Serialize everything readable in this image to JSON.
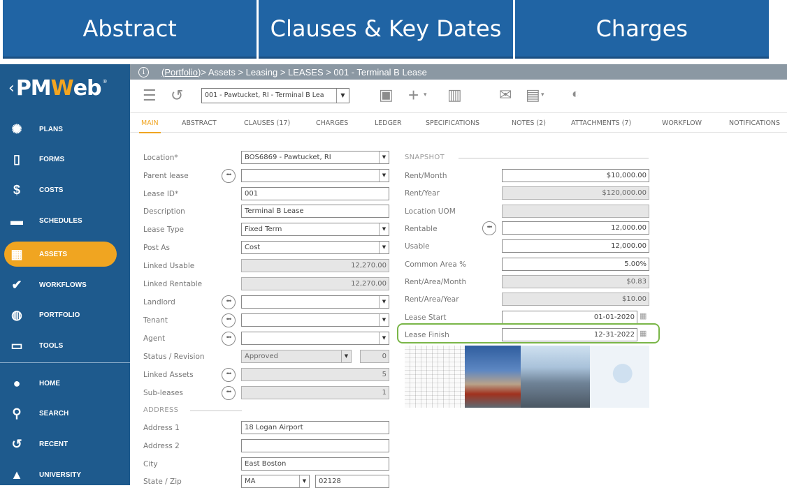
{
  "banner": {
    "tabs": [
      "Abstract",
      "Clauses & Key Dates",
      "Charges"
    ]
  },
  "sidebar": {
    "logo": {
      "arrow": "‹",
      "pm": "PM",
      "w": "W",
      "eb": "eb",
      "reg": "®"
    },
    "items": [
      {
        "icon": "plans-icon",
        "glyph": "✺",
        "label": "PLANS"
      },
      {
        "icon": "forms-icon",
        "glyph": "▯",
        "label": "FORMS"
      },
      {
        "icon": "costs-icon",
        "glyph": "$",
        "label": "COSTS"
      },
      {
        "icon": "schedules-icon",
        "glyph": "▬",
        "label": "SCHEDULES"
      },
      {
        "icon": "assets-icon",
        "glyph": "▦",
        "label": "ASSETS"
      },
      {
        "icon": "workflows-icon",
        "glyph": "✔",
        "label": "WORKFLOWS"
      },
      {
        "icon": "portfolio-icon",
        "glyph": "◍",
        "label": "PORTFOLIO"
      },
      {
        "icon": "tools-icon",
        "glyph": "▭",
        "label": "TOOLS"
      },
      {
        "icon": "home-icon",
        "glyph": "●",
        "label": "HOME"
      },
      {
        "icon": "search-icon",
        "glyph": "⚲",
        "label": "SEARCH"
      },
      {
        "icon": "recent-icon",
        "glyph": "↺",
        "label": "RECENT"
      },
      {
        "icon": "university-icon",
        "glyph": "▲",
        "label": "UNIVERSITY"
      }
    ],
    "active": "ASSETS"
  },
  "breadcrumb": {
    "info": "i",
    "link": "(Portfolio)",
    "rest": " > Assets > Leasing > LEASES > 001 - Terminal B Lease"
  },
  "toolbar": {
    "record": "001 - Pawtucket, RI - Terminal B Lea"
  },
  "tabs": [
    "MAIN",
    "ABSTRACT",
    "CLAUSES (17)",
    "CHARGES",
    "LEDGER",
    "SPECIFICATIONS",
    "NOTES (2)",
    "ATTACHMENTS (7)",
    "WORKFLOW",
    "NOTIFICATIONS"
  ],
  "form": {
    "location_label": "Location*",
    "location": "BOS6869 - Pawtucket, RI",
    "parent_label": "Parent lease",
    "parent": "",
    "lease_id_label": "Lease ID*",
    "lease_id": "001",
    "description_label": "Description",
    "description": "Terminal B Lease",
    "lease_type_label": "Lease Type",
    "lease_type": "Fixed Term",
    "post_as_label": "Post As",
    "post_as": "Cost",
    "linked_usable_label": "Linked Usable",
    "linked_usable": "12,270.00",
    "linked_rentable_label": "Linked Rentable",
    "linked_rentable": "12,270.00",
    "landlord_label": "Landlord",
    "landlord": "",
    "tenant_label": "Tenant",
    "tenant": "",
    "agent_label": "Agent",
    "agent": "",
    "status_label": "Status / Revision",
    "status": "Approved",
    "revision": "0",
    "linked_assets_label": "Linked Assets",
    "linked_assets": "5",
    "subleases_label": "Sub-leases",
    "subleases": "1"
  },
  "address": {
    "section": "ADDRESS",
    "address1_label": "Address 1",
    "address1": "18 Logan Airport",
    "address2_label": "Address 2",
    "address2": "",
    "city_label": "City",
    "city": "East Boston",
    "state_zip_label": "State / Zip",
    "state": "MA",
    "zip": "02128"
  },
  "snapshot": {
    "section": "SNAPSHOT",
    "rent_month_label": "Rent/Month",
    "rent_month": "$10,000.00",
    "rent_year_label": "Rent/Year",
    "rent_year": "$120,000.00",
    "location_uom_label": "Location UOM",
    "location_uom": "",
    "rentable_label": "Rentable",
    "rentable": "12,000.00",
    "usable_label": "Usable",
    "usable": "12,000.00",
    "common_area_label": "Common Area %",
    "common_area": "5.00%",
    "rent_area_month_label": "Rent/Area/Month",
    "rent_area_month": "$0.83",
    "rent_area_year_label": "Rent/Area/Year",
    "rent_area_year": "$10.00",
    "lease_start_label": "Lease Start",
    "lease_start": "01-01-2020",
    "lease_finish_label": "Lease Finish",
    "lease_finish": "12-31-2022"
  },
  "colors": {
    "banner": "#2064a4",
    "sidebar": "#1e5a8d",
    "accent": "#f0a521",
    "highlight": "#7ab648"
  }
}
